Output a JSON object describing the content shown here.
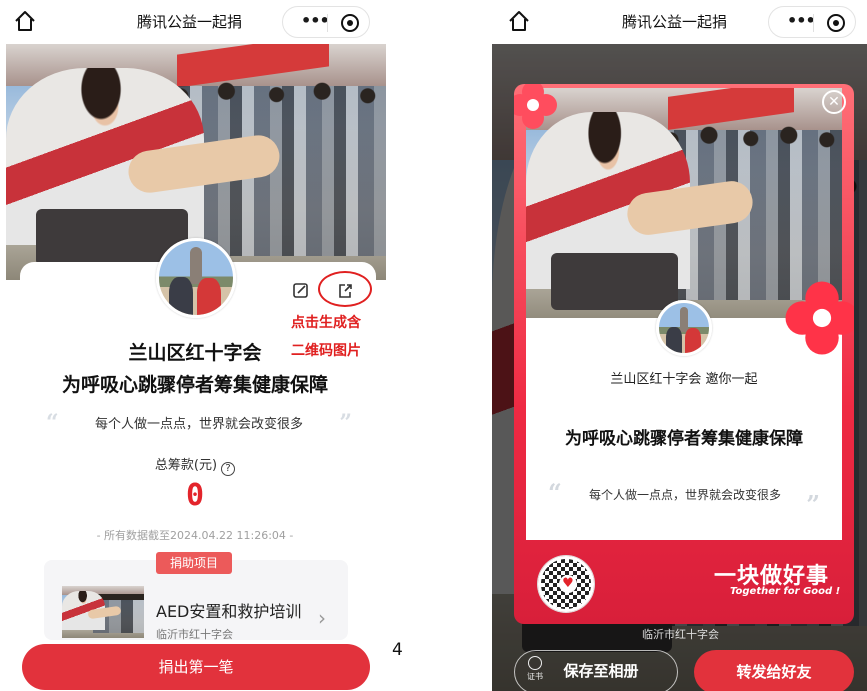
{
  "left": {
    "titlebar": {
      "title": "腾讯公益一起捐",
      "home_icon": "home-icon",
      "more_icon": "more-dots-icon",
      "target_icon": "target-icon"
    },
    "org_name": "兰山区红十字会",
    "project_title": "为呼吸心跳骤停者筹集健康保障",
    "slogan": "每个人做一点点，世界就会改变很多",
    "quote_open": "“",
    "quote_close": "”",
    "total_label": "总筹款(元)",
    "help_icon": "?",
    "total_amount": "0",
    "data_stamp": "- 所有数据截至2024.04.22 11:26:04 -",
    "annotation_line1": "点击生成含",
    "annotation_line2": "二维码图片",
    "project_section": {
      "tag": "捐助项目",
      "name": "AED安置和救护培训",
      "org": "临沂市红十字会",
      "chevron": "›"
    },
    "donate_button": "捐出第一笔",
    "page_number": "4"
  },
  "right": {
    "titlebar": {
      "title": "腾讯公益一起捐"
    },
    "poster": {
      "close": "✕",
      "inviter": "兰山区红十字会 邀你一起",
      "title": "为呼吸心跳骤停者筹集健康保障",
      "slogan": "每个人做一点点，世界就会改变很多",
      "quote_open": "“",
      "quote_close": "”",
      "slogan_big": "一块做好事",
      "slogan_en": "Together for Good !",
      "qr_heart": "♥"
    },
    "under_text": "临沂市红十字会",
    "cert_label": "证书",
    "save_button": "保存至相册",
    "forward_button": "转发给好友"
  },
  "colors": {
    "brand_red": "#e2323c",
    "amount_red": "#e3242b",
    "annotation_red": "#e02020"
  }
}
